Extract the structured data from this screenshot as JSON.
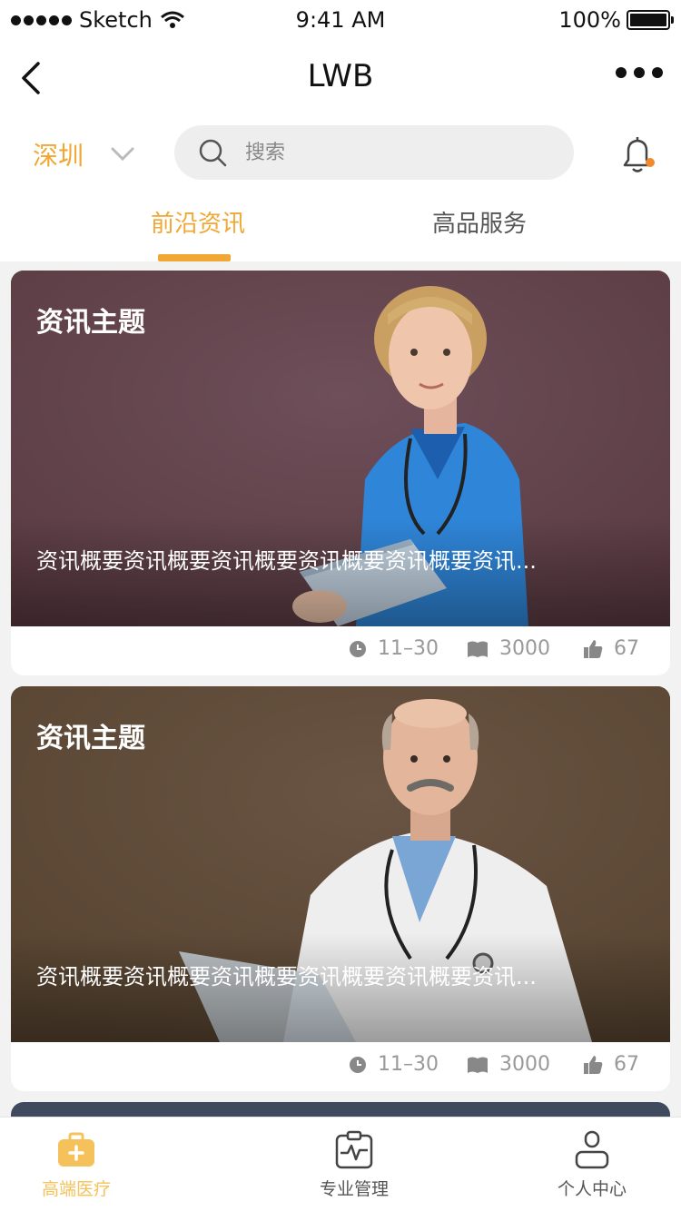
{
  "status_bar": {
    "carrier": "Sketch",
    "time": "9:41 AM",
    "battery": "100%"
  },
  "nav": {
    "title": "LWB"
  },
  "city": "深圳",
  "search": {
    "placeholder": "搜索"
  },
  "tabs": [
    {
      "label": "前沿资讯",
      "active": true
    },
    {
      "label": "高品服务",
      "active": false
    }
  ],
  "cards": [
    {
      "title": "资讯主题",
      "summary": "资讯概要资讯概要资讯概要资讯概要资讯概要资讯...",
      "date": "11–30",
      "views": "3000",
      "likes": "67",
      "bg": "#654650"
    },
    {
      "title": "资讯主题",
      "summary": "资讯概要资讯概要资讯概要资讯概要资讯概要资讯...",
      "date": "11–30",
      "views": "3000",
      "likes": "67",
      "bg": "#604c3f"
    }
  ],
  "tabbar": [
    {
      "label": "高端医疗",
      "icon": "medical-kit-icon",
      "active": true
    },
    {
      "label": "专业管理",
      "icon": "clipboard-pulse-icon",
      "active": false
    },
    {
      "label": "个人中心",
      "icon": "person-icon",
      "active": false
    }
  ],
  "colors": {
    "accent": "#f0a733",
    "notification_dot": "#f08a2c"
  }
}
